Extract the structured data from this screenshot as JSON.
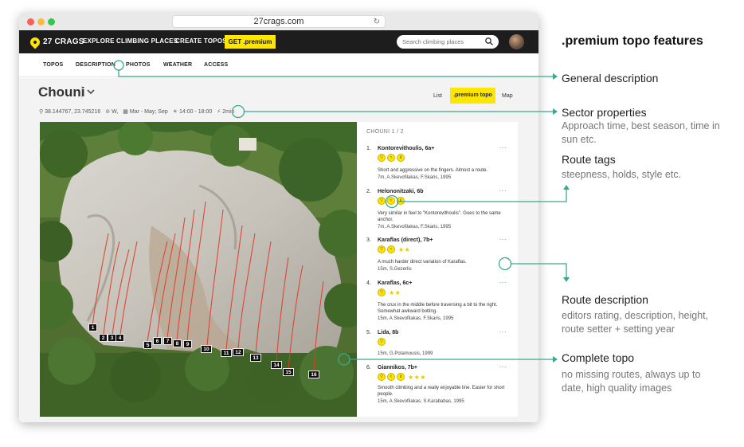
{
  "browser": {
    "url": "27crags.com"
  },
  "topnav": {
    "logo": "27 CRAGS",
    "links": [
      "EXPLORE CLIMBING PLACES",
      "CREATE TOPOS"
    ],
    "premium_button": "GET .premium",
    "search_placeholder": "Search climbing places"
  },
  "subnav": [
    "TOPOS",
    "DESCRIPTION",
    "PHOTOS",
    "WEATHER",
    "ACCESS"
  ],
  "sector": {
    "title": "Chouni",
    "views": {
      "list": "List",
      "premium": ".premium topo",
      "map": "Map"
    },
    "coords": "38.144767, 23.745216",
    "aspect": "W,",
    "season": "Mar - May; Sep",
    "sun": "14:00 - 18:00",
    "approach": "2min"
  },
  "panel": {
    "heading": "CHOUNI 1 / 2",
    "routes": [
      {
        "n": "1.",
        "name": "Kontorevithoulis, 6a+",
        "tags": 3,
        "stars": "",
        "desc": "Short and aggressive on the fingers. Almost a route.",
        "meta": "7m, A.Skevofilakas, F.Skaris, 1995"
      },
      {
        "n": "2.",
        "name": "Helononitzaki, 6b",
        "tags": 3,
        "stars": "",
        "desc": "Very similar in feel to \"Kontorevithoulis\". Goes to the same anchor.",
        "meta": "7m, A.Skevofilakas, F.Skaris, 1995"
      },
      {
        "n": "3.",
        "name": "Karaflas (direct), 7b+",
        "tags": 2,
        "stars": "★★",
        "desc": "A much harder direct variation of Karaflas.",
        "meta": "15m, S.Gezerlis"
      },
      {
        "n": "4.",
        "name": "Karaflas, 6c+",
        "tags": 1,
        "stars": "★★",
        "desc": "The crux in the middle before traversing a bit to the right. Somewhat awkward bolting.",
        "meta": "15m, A.Skevofilakas, F.Skaris, 1995"
      },
      {
        "n": "5.",
        "name": "Lida, 8b",
        "tags": 1,
        "stars": "",
        "desc": "",
        "meta": "15m, G.Potamousis, 1999"
      },
      {
        "n": "6.",
        "name": "Giannikos, 7b+",
        "tags": 3,
        "stars": "★★★",
        "desc": "Smooth climbing and a really enjoyable line. Easier for short people.",
        "meta": "15m, A.Skevofilakas, S.Karababas, 1995"
      }
    ]
  },
  "topo_numbers": [
    "1",
    "2",
    "3",
    "4",
    "5",
    "6",
    "7",
    "8",
    "9",
    "10",
    "11",
    "12",
    "13",
    "14",
    "15",
    "16"
  ],
  "callouts": {
    "heading": ".premium topo features",
    "general": {
      "title": "General description"
    },
    "sector": {
      "title": "Sector properties",
      "sub": "Approach time, best season, time in sun etc."
    },
    "tags": {
      "title": "Route tags",
      "sub": "steepness, holds, style etc."
    },
    "description": {
      "title": "Route description",
      "sub": "editors rating, description, height, route setter + setting year"
    },
    "topo": {
      "title": "Complete topo",
      "sub": "no missing routes, always up to date, high quality images"
    }
  },
  "colors": {
    "accent": "#ffe600",
    "callout": "#3aa98b",
    "nav": "#1d1d1d"
  }
}
